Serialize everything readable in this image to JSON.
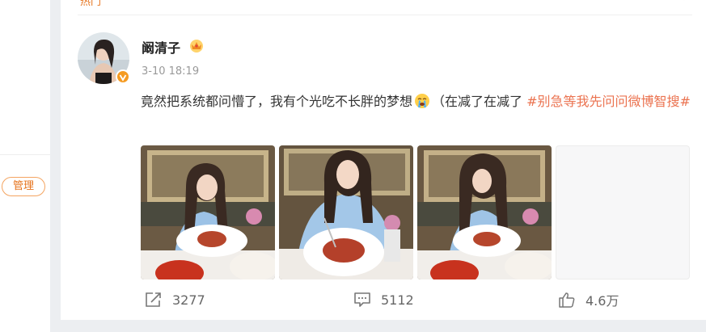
{
  "sidebar": {
    "manage_label": "管理"
  },
  "feed": {
    "tab_label": "热门"
  },
  "post": {
    "author": "阚清子",
    "time": "3-10 18:19",
    "text_main": "竟然把系统都问懵了，我有个光吃不长胖的梦想",
    "text_after_emoji": "（在减了在减了 ",
    "hashtag": "#别急等我先问问微博智搜#",
    "emoji_name": "crying-face",
    "verified_icon": "verified-badge",
    "vip_icon": "vip-crown",
    "photo_count": 4,
    "actions": {
      "repost": "3277",
      "comment": "5112",
      "like": "4.6万"
    }
  },
  "colors": {
    "accent": "#eb7350",
    "manage_border": "#f4a460",
    "verified": "#f59b22"
  }
}
